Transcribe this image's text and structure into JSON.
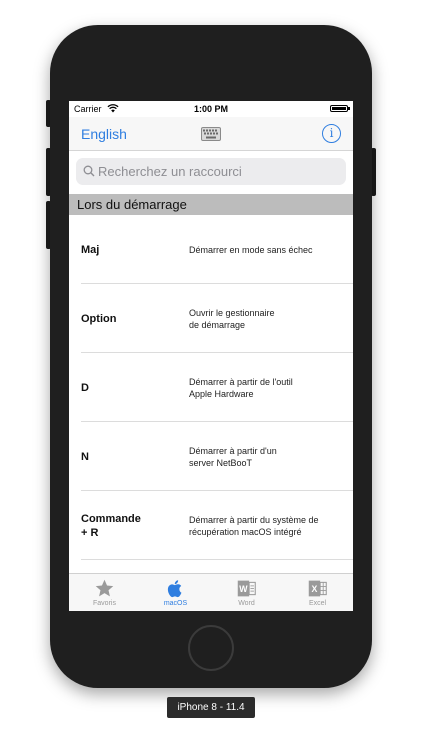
{
  "status_bar": {
    "carrier": "Carrier",
    "time": "1:00 PM"
  },
  "nav": {
    "language": "English",
    "keyboard_icon": "keyboard-icon",
    "info_icon": "info-icon",
    "info_glyph": "i"
  },
  "search": {
    "placeholder": "Recherchez un raccourci"
  },
  "section": {
    "title": "Lors du démarrage"
  },
  "rows": [
    {
      "key": "Maj",
      "description": "Démarrer en mode sans échec"
    },
    {
      "key": "Option",
      "description": "Ouvrir le gestionnaire\nde démarrage"
    },
    {
      "key": "D",
      "description": "Démarrer à partir de l'outil\nApple Hardware"
    },
    {
      "key": "N",
      "description": "Démarrer à partir d'un\nserver NetBooT"
    },
    {
      "key": "Commande\n+ R",
      "description": "Démarrer à partir du système de\nrécupération macOS intégré"
    }
  ],
  "tabs": [
    {
      "label": "Favoris",
      "icon": "star-icon"
    },
    {
      "label": "macOS",
      "icon": "apple-icon"
    },
    {
      "label": "Word",
      "icon": "word-icon"
    },
    {
      "label": "Excel",
      "icon": "excel-icon"
    }
  ],
  "colors": {
    "accent": "#2f7ee0",
    "section_header": "#bcbcbc",
    "device": "#1f1f1f"
  },
  "caption": "iPhone 8 - 11.4"
}
